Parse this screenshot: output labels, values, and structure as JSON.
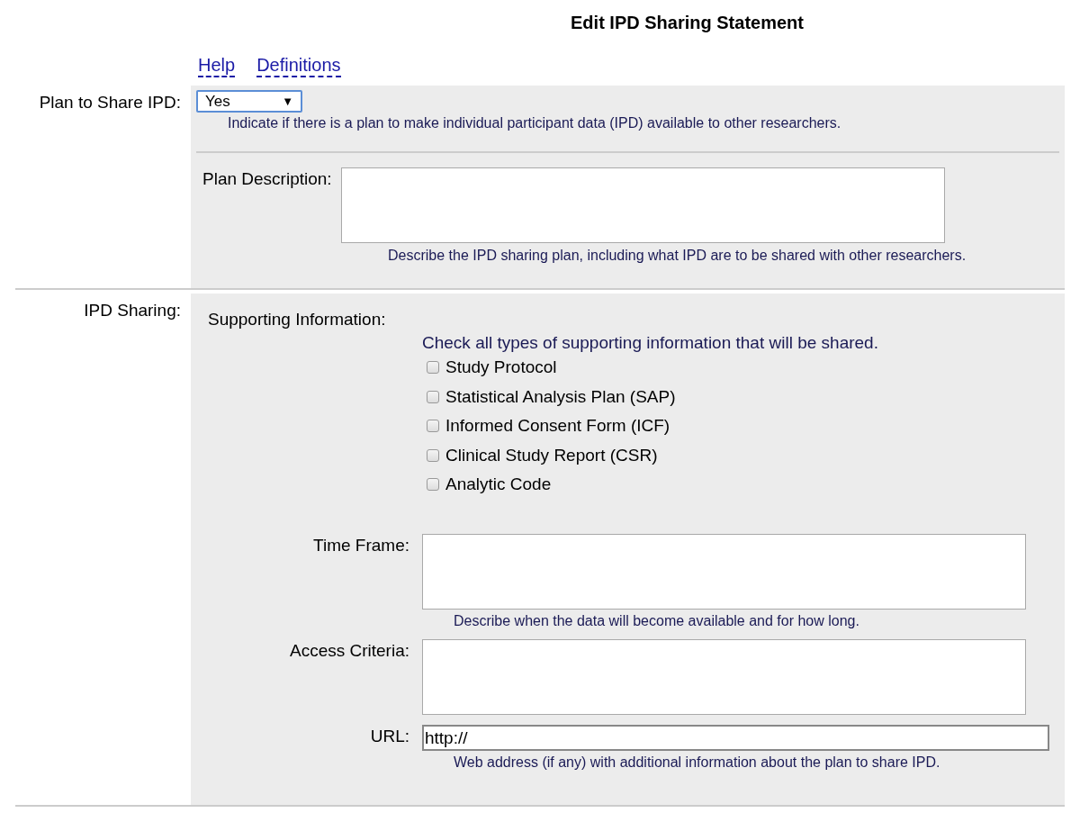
{
  "title": "Edit IPD Sharing Statement",
  "links": [
    {
      "label": "Help"
    },
    {
      "label": "Definitions"
    }
  ],
  "plan": {
    "label": "Plan to Share IPD:",
    "select": {
      "value": "Yes",
      "arrow": "▼"
    },
    "hint": "Indicate if there is a plan to make individual participant data (IPD) available to other researchers.",
    "description": {
      "label": "Plan Description:",
      "hint": "Describe the IPD sharing plan, including what IPD are to be shared with other researchers."
    }
  },
  "ipd_sharing": {
    "label": "IPD Sharing:",
    "supporting": {
      "label": "Supporting Information:",
      "instruction": "Check all types of supporting information that will be shared.",
      "options": [
        {
          "label": "Study Protocol",
          "checked": false
        },
        {
          "label": "Statistical Analysis Plan (SAP)",
          "checked": false
        },
        {
          "label": "Informed Consent Form (ICF)",
          "checked": false
        },
        {
          "label": "Clinical Study Report (CSR)",
          "checked": false
        },
        {
          "label": "Analytic Code",
          "checked": false
        }
      ]
    },
    "fields": [
      {
        "kind": "textarea",
        "label": "Time Frame:",
        "hint": "Describe when the data will become available and for how long."
      },
      {
        "kind": "textarea",
        "label": "Access Criteria:"
      },
      {
        "kind": "text",
        "label": "URL:",
        "value": "http://",
        "hint": "Web address (if any) with additional information about the plan to share IPD."
      }
    ]
  }
}
